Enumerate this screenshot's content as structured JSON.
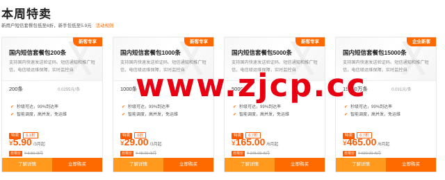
{
  "page": {
    "title": "本周特卖",
    "subtitle": "新用户短信套餐包低至6折，新手包低至5.9元",
    "rules_link": "活动规则"
  },
  "cards": [
    {
      "tag": "新客专享",
      "title": "国内短信套餐包200条",
      "description": "支持国内快速发送验证码、短信通知和推广短信，电信级运维保障，实时监控自",
      "quantity": "200条",
      "unit_price": "0.0295元/条",
      "features": [
        "秒级可达，99%到达率",
        "智能调度，高并发，免运维"
      ],
      "sale_badge": "特卖",
      "discount": "6.1折",
      "currency": "¥",
      "price": "5.90",
      "price_suffix": "/3月起",
      "orig_tag": "日常价",
      "orig_price": "¥ 9.50 /3月"
    },
    {
      "tag": "新客专享",
      "title": "国内短信套餐包1000条",
      "description": "支持国内快速发送验证码、短信通知和推广短信，电信级运维保障，实时监控自",
      "quantity": "1000条",
      "unit_price": "",
      "features": [
        "秒级可达，99%到达率",
        "智能调度，高并发，免运维"
      ],
      "sale_badge": "特卖",
      "discount": "6折",
      "currency": "¥",
      "price": "29.00",
      "price_suffix": "/3月起",
      "orig_tag": "日常价",
      "orig_price": "¥ 48.00 /3月"
    },
    {
      "tag": "新客专享",
      "title": "国内短信套餐包5000条",
      "description": "支持国内快速发送验证码、短信通知和推广短信，电信级运维保障，实时监控自",
      "quantity": "5000条",
      "unit_price": "",
      "features": [
        "秒级可达，99%到达率",
        "智能调度，高并发，免运维"
      ],
      "sale_badge": "特卖",
      "discount": "6.7折",
      "currency": "¥",
      "price": "165.00",
      "price_suffix": "/6月起",
      "orig_tag": "日常价",
      "orig_price": "¥ 245.00 /6月"
    },
    {
      "tag": "企业新客",
      "title": "国内短信套餐包15000条",
      "description": "支持国内快速发送验证码、短信通知和推广短信，电信级运维保障，实时监控自",
      "quantity": "15000万条",
      "unit_price": "0.031元/条",
      "features": [
        "秒级可达，99%到达率",
        "智能调度，高并发，免运维"
      ],
      "sale_badge": "特卖",
      "discount": "6.7折",
      "currency": "¥",
      "price": "465.00",
      "price_suffix": "/6月起",
      "orig_tag": "日常价",
      "orig_price": "¥ 690.00 /6月"
    }
  ],
  "buttons": {
    "detail": "了解详情",
    "buy": "立即购买"
  },
  "watermark": "www.zjcp.cc",
  "colors": {
    "accent": "#ff6a00",
    "accent_light": "#ff9a1e",
    "watermark": "#e60012"
  }
}
